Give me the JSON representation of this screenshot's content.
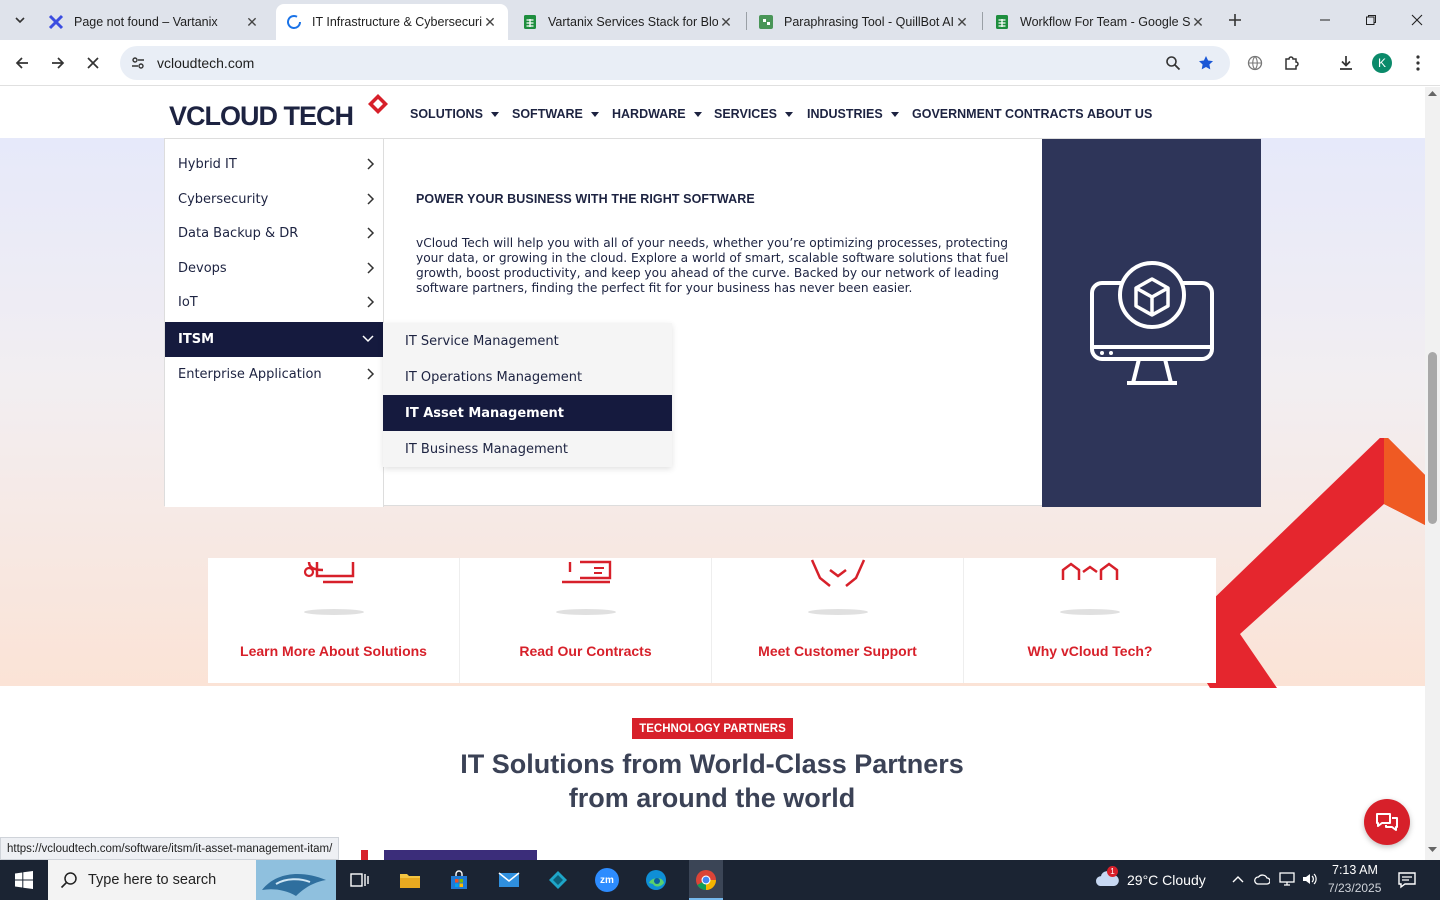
{
  "browser": {
    "tabs": [
      {
        "title": "Page not found – Vartanix",
        "icon": "vartanix-x-icon",
        "active": false
      },
      {
        "title": "IT Infrastructure & Cybersecurit",
        "icon": "loading-spinner-icon",
        "active": true
      },
      {
        "title": "Vartanix Services Stack for Blog",
        "icon": "google-sheets-icon",
        "active": false
      },
      {
        "title": "Paraphrasing Tool - QuillBot AI",
        "icon": "quillbot-icon",
        "active": false
      },
      {
        "title": "Workflow For Team - Google Sh",
        "icon": "google-sheets-icon",
        "active": false
      }
    ],
    "url": "vcloudtech.com",
    "profile_initial": "K",
    "status_url": "https://vcloudtech.com/software/itsm/it-asset-management-itam/"
  },
  "site": {
    "logo_text": "VCLOUD TECH",
    "nav": [
      {
        "label": "SOLUTIONS",
        "dropdown": true
      },
      {
        "label": "SOFTWARE",
        "dropdown": true
      },
      {
        "label": "HARDWARE",
        "dropdown": true
      },
      {
        "label": "SERVICES",
        "dropdown": true
      },
      {
        "label": "INDUSTRIES",
        "dropdown": true
      },
      {
        "label": "GOVERNMENT CONTRACTS",
        "dropdown": false
      },
      {
        "label": "ABOUT US",
        "dropdown": false
      }
    ],
    "mega_menu": {
      "categories": [
        {
          "label": "Hybrid IT",
          "active": false
        },
        {
          "label": "Cybersecurity",
          "active": false
        },
        {
          "label": "Data Backup & DR",
          "active": false
        },
        {
          "label": "Devops",
          "active": false
        },
        {
          "label": "IoT",
          "active": false
        },
        {
          "label": "ITSM",
          "active": true
        },
        {
          "label": "Enterprise Application",
          "active": false
        }
      ],
      "submenu": [
        {
          "label": "IT Service Management",
          "active": false
        },
        {
          "label": "IT Operations Management",
          "active": false
        },
        {
          "label": "IT Asset Management",
          "active": true
        },
        {
          "label": "IT Business Management",
          "active": false
        }
      ],
      "heading": "POWER YOUR BUSINESS WITH THE RIGHT SOFTWARE",
      "description": "vCloud Tech will help you with all of your needs, whether you’re optimizing processes, protecting your data, or growing in the cloud. Explore a world of smart, scalable software solutions that fuel growth, boost productivity, and keep you ahead of the curve. Backed by our network of leading software partners, finding the perfect fit for your business has never been easier.",
      "image_icon": "monitor-cube-icon"
    },
    "cards": [
      {
        "label": "Learn More About Solutions",
        "icon": "network-computer-icon"
      },
      {
        "label": "Read Our Contracts",
        "icon": "contract-certificate-icon"
      },
      {
        "label": "Meet Customer Support",
        "icon": "handshake-support-icon"
      },
      {
        "label": "Why vCloud Tech?",
        "icon": "team-people-icon"
      }
    ],
    "partners": {
      "badge": "TECHNOLOGY PARTNERS",
      "title_line1": "IT Solutions from World-Class Partners",
      "title_line2": "from around the world"
    }
  },
  "taskbar": {
    "search_placeholder": "Type here to search",
    "weather": "29°C  Cloudy",
    "weather_badge": "1",
    "time": "7:13 AM",
    "date": "7/23/2025"
  },
  "colors": {
    "brand_red": "#d7202a",
    "navy": "#151a3e",
    "panel_navy": "#2e3559"
  }
}
